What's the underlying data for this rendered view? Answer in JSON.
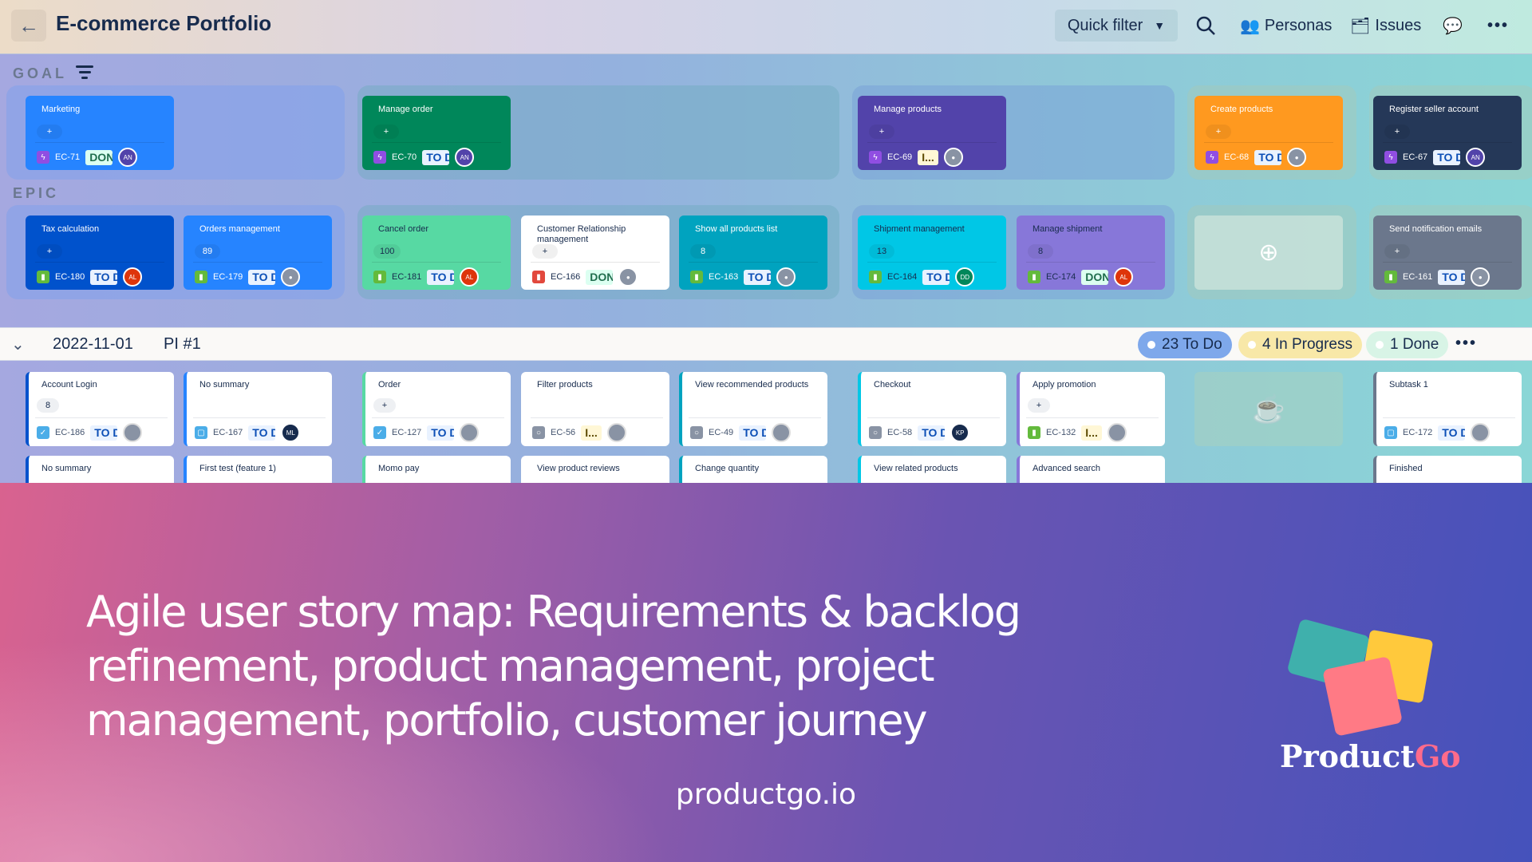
{
  "header": {
    "title": "E-commerce Portfolio",
    "quick_filter": "Quick filter",
    "personas": "Personas",
    "issues": "Issues"
  },
  "rows": {
    "goal": "GOAL",
    "epic": "EPIC"
  },
  "goals": [
    {
      "title": "Marketing",
      "key": "EC-71",
      "status": "DONE",
      "assignee": "AN",
      "color": "#2684ff"
    },
    {
      "title": "Manage order",
      "key": "EC-70",
      "status": "TO DO",
      "assignee": "AN",
      "color": "#00875a"
    },
    {
      "title": "Manage products",
      "key": "EC-69",
      "status": "IN PROGRESS",
      "assignee": "",
      "color": "#5243aa"
    },
    {
      "title": "Create products",
      "key": "EC-68",
      "status": "TO DO",
      "assignee": "",
      "color": "#ff991f"
    },
    {
      "title": "Register seller account",
      "key": "EC-67",
      "status": "TO DO",
      "assignee": "AN",
      "color": "#253858"
    }
  ],
  "epics": [
    {
      "title": "Tax calculation",
      "points": "+",
      "key": "EC-180",
      "status": "TO DO",
      "assignee": "AL",
      "color": "#0052cc"
    },
    {
      "title": "Orders management",
      "points": "89",
      "key": "EC-179",
      "status": "TO DO",
      "assignee": "",
      "color": "#2684ff"
    },
    {
      "title": "Cancel order",
      "points": "100",
      "key": "EC-181",
      "status": "TO DO",
      "assignee": "AL",
      "color": "#57d9a3"
    },
    {
      "title": "Customer Relationship management",
      "points": "",
      "key": "EC-166",
      "status": "DONE",
      "assignee": "",
      "color": "#ffffff"
    },
    {
      "title": "Show all products list",
      "points": "8",
      "key": "EC-163",
      "status": "TO DO",
      "assignee": "",
      "color": "#00a3bf"
    },
    {
      "title": "Shipment management",
      "points": "13",
      "key": "EC-164",
      "status": "TO DO",
      "assignee": "DD",
      "color": "#00c7e6"
    },
    {
      "title": "Manage shipment",
      "points": "8",
      "key": "EC-174",
      "status": "DONE",
      "assignee": "AL",
      "color": "#8777d9"
    },
    {
      "title": "Send notification emails",
      "points": "+",
      "key": "EC-161",
      "status": "TO DO",
      "assignee": "",
      "color": "#6b778c"
    }
  ],
  "release": {
    "date": "2022-11-01",
    "name": "PI #1",
    "todo": "23 To Do",
    "in_progress": "4 In Progress",
    "done": "1 Done"
  },
  "stories": [
    {
      "title": "Account Login",
      "points": "8",
      "key": "EC-186",
      "status": "TO DO",
      "type": "task"
    },
    {
      "title": "No summary",
      "points": "",
      "key": "EC-167",
      "status": "TO DO",
      "type": "subtask",
      "assignee": "ML"
    },
    {
      "title": "Order",
      "points": "+",
      "key": "EC-127",
      "status": "TO DO",
      "type": "task"
    },
    {
      "title": "Filter products",
      "points": "",
      "key": "EC-56",
      "status": "IN PROGRESS",
      "type": "gray"
    },
    {
      "title": "View recommended products",
      "points": "",
      "key": "EC-49",
      "status": "TO DO",
      "type": "gray"
    },
    {
      "title": "Checkout",
      "points": "",
      "key": "EC-58",
      "status": "TO DO",
      "type": "gray",
      "assignee": "KP"
    },
    {
      "title": "Apply promotion",
      "points": "+",
      "key": "EC-132",
      "status": "IN PROGRESS",
      "type": "story"
    },
    {
      "title": "Subtask 1",
      "points": "",
      "key": "EC-172",
      "status": "TO DO",
      "type": "subtask"
    }
  ],
  "stories_row2": [
    "No summary",
    "First test (feature 1)",
    "Momo pay",
    "View product reviews",
    "Change quantity",
    "View related products",
    "Advanced search",
    "Finished"
  ],
  "promo": {
    "headline": "Agile user story map: Requirements & backlog refinement, product management, project management, portfolio, customer journey",
    "site": "productgo.io",
    "brand_a": "Product",
    "brand_b": "Go"
  }
}
